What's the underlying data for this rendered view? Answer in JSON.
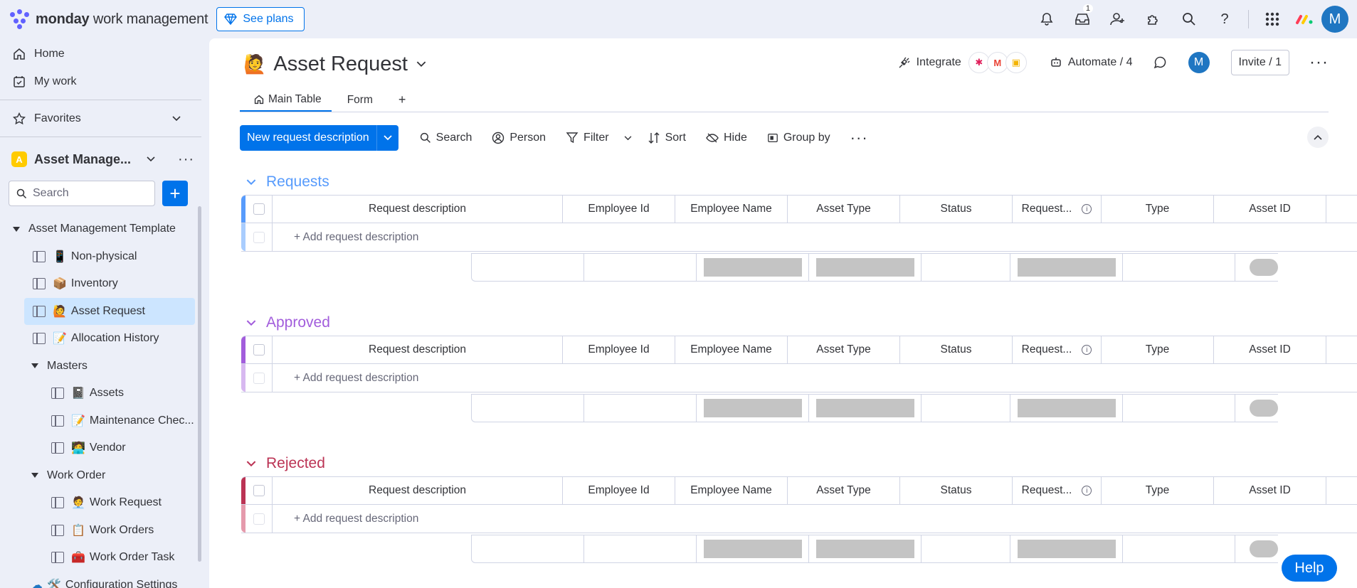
{
  "topbar": {
    "brand_bold": "monday",
    "brand_rest": " work management",
    "see_plans": "See plans",
    "inbox_badge": "1",
    "avatar_letter": "M"
  },
  "sidebar": {
    "nav": [
      {
        "label": "Home",
        "icon": "home-icon"
      },
      {
        "label": "My work",
        "icon": "calendar-check-icon"
      },
      {
        "label": "Favorites",
        "icon": "star-icon"
      }
    ],
    "workspace": {
      "icon_letter": "A",
      "name": "Asset Manage..."
    },
    "search_placeholder": "Search",
    "tree": {
      "root": "Asset Management Template",
      "items": [
        {
          "label": "Non-physical",
          "emoji": "📱",
          "level": 1
        },
        {
          "label": "Inventory",
          "emoji": "📦",
          "level": 1
        },
        {
          "label": "Asset Request",
          "emoji": "🙋",
          "level": 1,
          "active": true
        },
        {
          "label": "Allocation History",
          "emoji": "📝",
          "level": 1
        }
      ],
      "masters_folder": "Masters",
      "masters": [
        {
          "label": "Assets",
          "emoji": "📓"
        },
        {
          "label": "Maintenance Chec...",
          "emoji": "📝"
        },
        {
          "label": "Vendor",
          "emoji": "🧑‍💻"
        }
      ],
      "work_order_folder": "Work Order",
      "work_orders": [
        {
          "label": "Work Request",
          "emoji": "🧑‍💼"
        },
        {
          "label": "Work Orders",
          "emoji": "📋"
        },
        {
          "label": "Work Order Task",
          "emoji": "🧰"
        }
      ],
      "config": {
        "label": "Configuration Settings",
        "emoji": "🛠️"
      }
    }
  },
  "board": {
    "emoji": "🙋",
    "title": "Asset Request",
    "integrate": "Integrate",
    "automate": "Automate / 4",
    "avatar_letter": "M",
    "invite": "Invite / 1",
    "tabs": [
      {
        "label": "Main Table",
        "active": true
      },
      {
        "label": "Form",
        "active": false
      },
      {
        "label": "+",
        "active": false
      }
    ],
    "toolbar": {
      "new_item": "New request description",
      "search": "Search",
      "person": "Person",
      "filter": "Filter",
      "sort": "Sort",
      "hide": "Hide",
      "group_by": "Group by"
    },
    "columns": [
      "Request description",
      "Employee Id",
      "Employee Name",
      "Asset Type",
      "Status",
      "Request...",
      "Type",
      "Asset ID"
    ],
    "add_row_label": "+ Add request description",
    "groups": [
      {
        "title": "Requests",
        "color": "#579bfc",
        "light": "#a9cdfe"
      },
      {
        "title": "Approved",
        "color": "#a25ddc",
        "light": "#d7b8f0"
      },
      {
        "title": "Rejected",
        "color": "#bb3354",
        "light": "#e59aac"
      }
    ]
  },
  "help": "Help"
}
